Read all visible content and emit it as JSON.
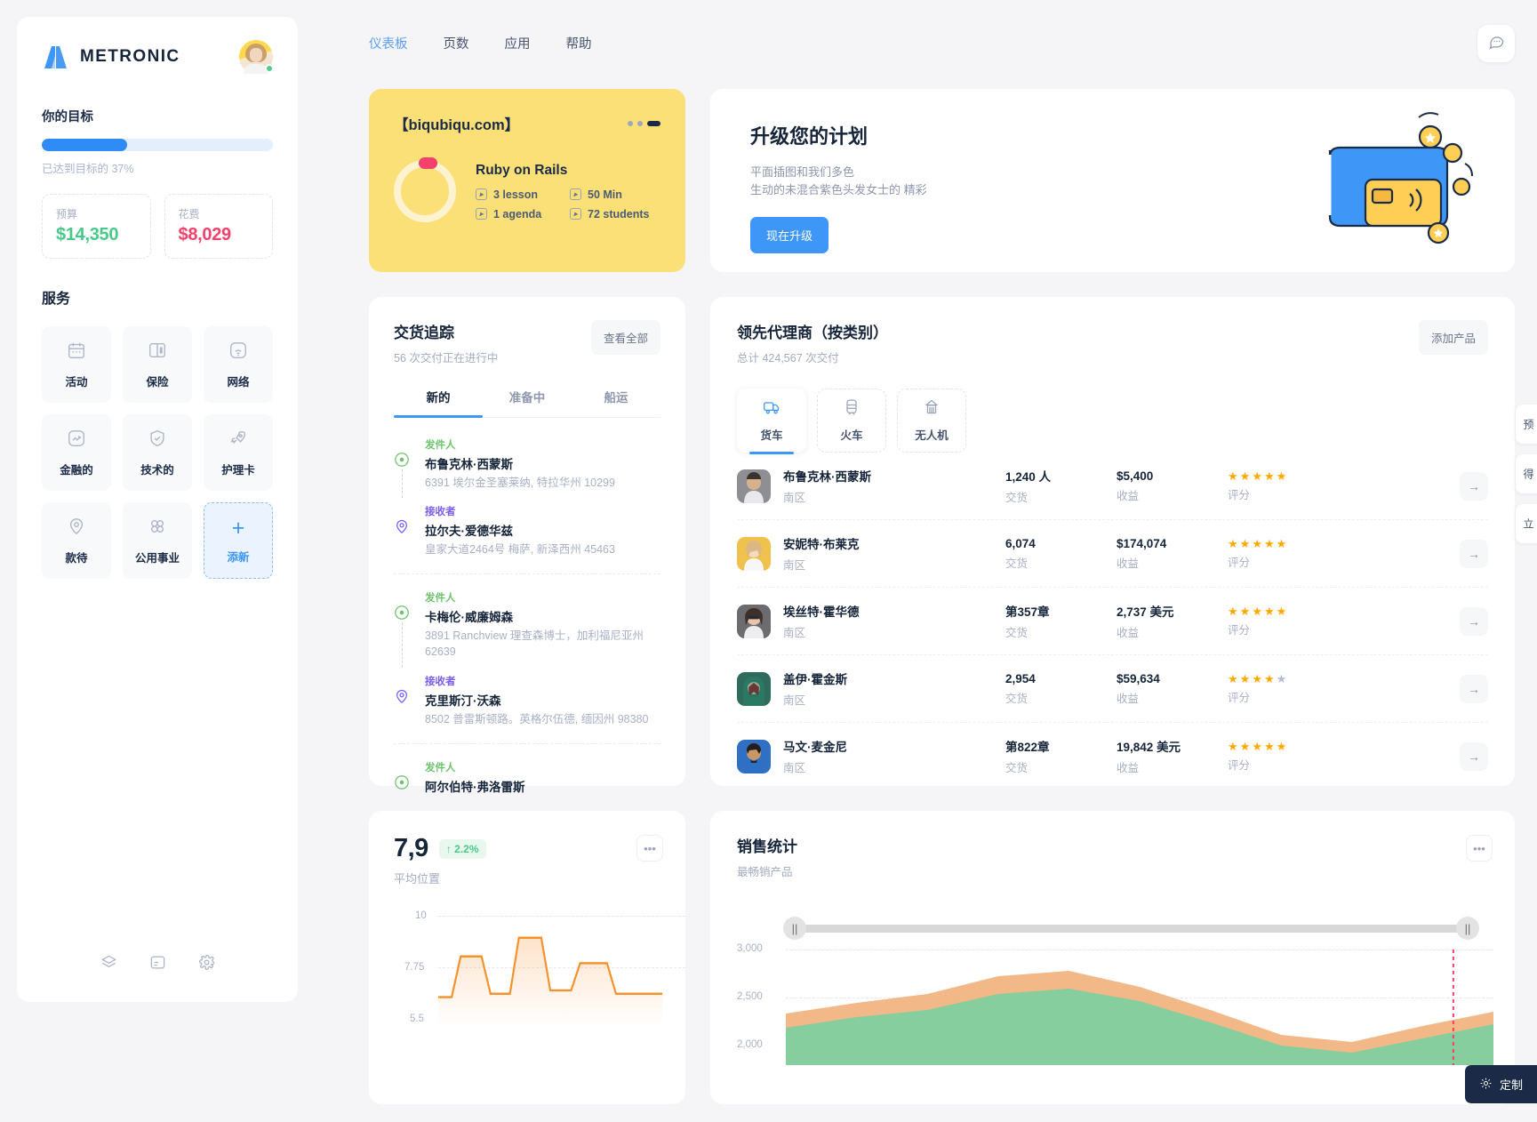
{
  "brand": {
    "name": "METRONIC"
  },
  "sidebar": {
    "goal_title": "你的目标",
    "goal_progress_label": "已达到目标的 37%",
    "goal_percent": 37,
    "stats": [
      {
        "label": "预算",
        "value": "$14,350",
        "color": "#48c98a"
      },
      {
        "label": "花费",
        "value": "$8,029",
        "color": "#f1416c"
      }
    ],
    "services_title": "服务",
    "services": [
      {
        "label": "活动",
        "icon": "calendar-icon"
      },
      {
        "label": "保险",
        "icon": "book-icon"
      },
      {
        "label": "网络",
        "icon": "wifi-icon"
      },
      {
        "label": "金融的",
        "icon": "chart-up-icon"
      },
      {
        "label": "技术的",
        "icon": "shield-check-icon"
      },
      {
        "label": "护理卡",
        "icon": "rocket-icon"
      },
      {
        "label": "款待",
        "icon": "location-pin-icon"
      },
      {
        "label": "公用事业",
        "icon": "four-circles-icon"
      },
      {
        "label": "添新",
        "icon": "plus-icon"
      }
    ],
    "footer_icons": [
      "layers-icon",
      "note-icon",
      "gear-icon"
    ]
  },
  "topnav": {
    "items": [
      {
        "label": "仪表板",
        "active": true
      },
      {
        "label": "页数",
        "active": false
      },
      {
        "label": "应用",
        "active": false
      },
      {
        "label": "帮助",
        "active": false
      }
    ],
    "chat_icon": "chat-icon"
  },
  "course_card": {
    "site": "【biqubiqu.com】",
    "title": "Ruby on Rails",
    "meta": [
      {
        "label": "3 lesson"
      },
      {
        "label": "50 Min"
      },
      {
        "label": "1 agenda"
      },
      {
        "label": "72 students"
      }
    ]
  },
  "upgrade_card": {
    "title": "升级您的计划",
    "desc_line1": "平面插图和我们多色",
    "desc_line2": "生动的未混合紫色头发女士的 精彩",
    "button": "现在升级"
  },
  "delivery_card": {
    "title": "交货追踪",
    "subtitle": "56 次交付正在进行中",
    "view_all": "查看全部",
    "tabs": [
      {
        "label": "新的",
        "active": true
      },
      {
        "label": "准备中",
        "active": false
      },
      {
        "label": "船运",
        "active": false
      }
    ],
    "groups": [
      {
        "nodes": [
          {
            "role": "发件人",
            "type": "sender",
            "name": "布鲁克林·西蒙斯",
            "addr": "6391 埃尔金圣塞莱纳, 特拉华州 10299"
          },
          {
            "role": "接收者",
            "type": "receiver",
            "name": "拉尔夫·爱德华兹",
            "addr": "皇家大道2464号 梅萨, 新泽西州 45463"
          }
        ]
      },
      {
        "nodes": [
          {
            "role": "发件人",
            "type": "sender",
            "name": "卡梅伦·威廉姆森",
            "addr": "3891 Ranchview 理查森博士，加利福尼亚州 62639"
          },
          {
            "role": "接收者",
            "type": "receiver",
            "name": "克里斯汀·沃森",
            "addr": "8502 普雷斯顿路。英格尔伍德, 缅因州 98380"
          }
        ]
      },
      {
        "nodes": [
          {
            "role": "发件人",
            "type": "sender",
            "name": "阿尔伯特·弗洛雷斯",
            "addr": ""
          }
        ]
      }
    ]
  },
  "agents_card": {
    "title": "领先代理商（按类别）",
    "subtitle": "总计 424,567 次交付",
    "add_button": "添加产品",
    "transport_tabs": [
      {
        "label": "货车",
        "icon": "truck-icon",
        "active": true
      },
      {
        "label": "火车",
        "icon": "train-icon",
        "active": false
      },
      {
        "label": "无人机",
        "icon": "drone-icon",
        "active": false
      }
    ],
    "col_labels": {
      "delivery": "交货",
      "revenue": "收益",
      "rating": "评分"
    },
    "rows": [
      {
        "name": "布鲁克林·西蒙斯",
        "region": "南区",
        "delivery": "1,240 人",
        "revenue": "$5,400",
        "stars": 5,
        "avatar": "#8d8f94"
      },
      {
        "name": "安妮特·布莱克",
        "region": "南区",
        "delivery": "6,074",
        "revenue": "$174,074",
        "stars": 5,
        "avatar": "#f0c14b"
      },
      {
        "name": "埃丝特·霍华德",
        "region": "南区",
        "delivery": "第357章",
        "revenue": "2,737 美元",
        "stars": 5,
        "avatar": "#6b6b70"
      },
      {
        "name": "盖伊·霍金斯",
        "region": "南区",
        "delivery": "2,954",
        "revenue": "$59,634",
        "stars": 4,
        "avatar": "#2f6b5c"
      },
      {
        "name": "马文·麦金尼",
        "region": "南区",
        "delivery": "第822章",
        "revenue": "19,842 美元",
        "stars": 5,
        "avatar": "#2f6fc4"
      }
    ]
  },
  "position_card": {
    "value": "7,9",
    "delta": "↑ 2.2%",
    "label": "平均位置",
    "menu_icon": "ellipsis-icon"
  },
  "sales_card": {
    "title": "销售统计",
    "subtitle": "最畅销产品",
    "menu_icon": "ellipsis-icon"
  },
  "rail": {
    "items": [
      "预",
      "得",
      "立"
    ]
  },
  "customize_button": {
    "label": "定制",
    "icon": "gear-icon"
  },
  "chart_data": [
    {
      "type": "line",
      "title": "平均位置",
      "ylabel": "",
      "xlabel": "",
      "ylim": [
        5.5,
        10
      ],
      "yticks": [
        10,
        7.75,
        5.5
      ],
      "ytick_labels": [
        "10",
        "7.75",
        "5.5"
      ],
      "grid": true,
      "series": [
        {
          "name": "position",
          "color": "#f5a04e",
          "values": [
            6.2,
            6.2,
            7.6,
            7.6,
            6.3,
            6.2,
            8.6,
            8.6,
            6.4,
            7.4,
            7.4,
            6.3
          ]
        }
      ]
    },
    {
      "type": "area",
      "title": "销售统计",
      "subtitle": "最畅销产品",
      "ylim": [
        2000,
        3000
      ],
      "yticks": [
        3000,
        2500,
        2000
      ],
      "ytick_labels": [
        "3,000",
        "2,500",
        "2,000"
      ],
      "grid": true,
      "legend": "none",
      "series": [
        {
          "name": "series-green",
          "color": "#7fcf9e",
          "values": [
            2280,
            2360,
            2410,
            2520,
            2560,
            2480,
            2330,
            2150,
            2090,
            2180
          ]
        },
        {
          "name": "series-orange",
          "color": "#f2b07a",
          "values": [
            2430,
            2470,
            2530,
            2590,
            2610,
            2500,
            2300,
            2120,
            2060,
            2240
          ]
        }
      ]
    }
  ]
}
